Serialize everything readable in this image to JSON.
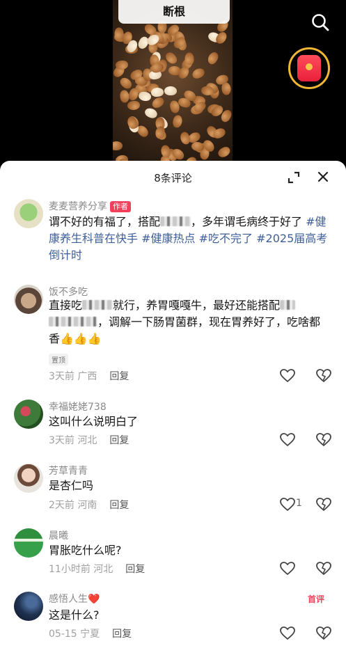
{
  "video": {
    "caption": "断根"
  },
  "comments_panel": {
    "title": "8条评论"
  },
  "comments": [
    {
      "username": "麦麦营养分享",
      "author_tag": "作者",
      "text_part1": "谓不好的有福了，搭配",
      "text_part2": "，多年谓毛病终于好了",
      "hashtags": [
        "#健康养生科普在快手",
        "#健康热点",
        "#吃不完了",
        "#2025届高考倒计时"
      ]
    },
    {
      "username": "饭不多吃",
      "text_part1": "直接吃",
      "text_part2": "就行，养胃嘎嘎牛，最好还能搭配",
      "text_part3": "，调解一下肠胃菌群，现在胃养好了，吃啥都香👍👍👍",
      "pinned": "置顶",
      "time": "3天前",
      "location": "广西",
      "reply": "回复"
    },
    {
      "username": "幸福姥姥738",
      "text": "这叫什么说明白了",
      "time": "3天前",
      "location": "河北",
      "reply": "回复"
    },
    {
      "username": "芳草青青",
      "text": "是杏仁吗",
      "time": "2天前",
      "location": "河南",
      "reply": "回复",
      "likes": "1"
    },
    {
      "username": "晨曦",
      "text": "胃胀吃什么呢?",
      "time": "11小时前",
      "location": "河北",
      "reply": "回复"
    },
    {
      "username": "感悟人生❤️",
      "text": "这是什么?",
      "time": "05-15",
      "location": "宁夏",
      "reply": "回复",
      "badge": "首评"
    }
  ],
  "colors": {
    "accent": "#f0405a",
    "hashtag": "#3e5f99",
    "meta": "#a0a0a0"
  }
}
